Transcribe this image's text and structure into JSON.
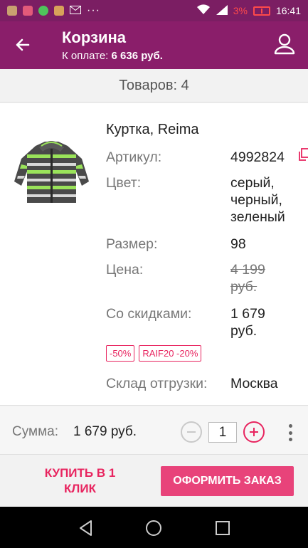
{
  "status_bar": {
    "battery_percent": "3%",
    "time": "16:41",
    "icons": [
      "app-icon",
      "app-icon",
      "whatsapp-icon",
      "app-icon",
      "mail-icon",
      "more-icon",
      "wifi-icon",
      "signal-icon",
      "battery-icon"
    ]
  },
  "app_bar": {
    "title": "Корзина",
    "subtitle_prefix": "К оплате: ",
    "subtitle_amount": "6 636 руб."
  },
  "items_count": "Товаров: 4",
  "product": {
    "name": "Куртка, Reima",
    "article_label": "Артикул:",
    "article_value": "4992824",
    "color_label": "Цвет:",
    "color_value": "серый, черный, зеленый",
    "size_label": "Размер:",
    "size_value": "98",
    "price_label": "Цена:",
    "price_value": "4 199 руб.",
    "discount_label": "Со скидками:",
    "discount_value": "1 679 руб.",
    "badges": [
      "-50%",
      "RAIF20 -20%"
    ],
    "warehouse_label": "Склад отгрузки:",
    "warehouse_value": "Москва"
  },
  "sum": {
    "label": "Сумма:",
    "value": "1 679 руб.",
    "quantity": "1"
  },
  "actions": {
    "buy_one_click": "КУПИТЬ В 1 КЛИК",
    "checkout": "ОФОРМИТЬ ЗАКАЗ"
  },
  "colors": {
    "primary": "#8a1e6a",
    "accent": "#e8245f",
    "checkout_button": "#e8437a"
  }
}
